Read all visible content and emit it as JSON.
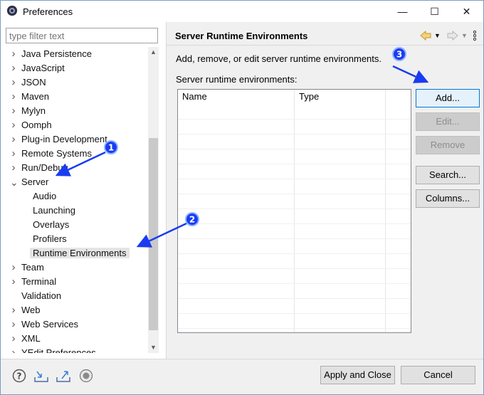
{
  "window": {
    "title": "Preferences",
    "minimize_glyph": "—",
    "maximize_glyph": "☐",
    "close_glyph": "✕"
  },
  "filter": {
    "placeholder": "type filter text"
  },
  "tree": {
    "items": [
      {
        "label": "Java Persistence",
        "expandable": true
      },
      {
        "label": "JavaScript",
        "expandable": true
      },
      {
        "label": "JSON",
        "expandable": true
      },
      {
        "label": "Maven",
        "expandable": true
      },
      {
        "label": "Mylyn",
        "expandable": true
      },
      {
        "label": "Oomph",
        "expandable": true
      },
      {
        "label": "Plug-in Development",
        "expandable": true
      },
      {
        "label": "Remote Systems",
        "expandable": true
      },
      {
        "label": "Run/Debug",
        "expandable": true
      },
      {
        "label": "Server",
        "expandable": true,
        "expanded": true
      },
      {
        "label": "Audio",
        "child": true
      },
      {
        "label": "Launching",
        "child": true
      },
      {
        "label": "Overlays",
        "child": true
      },
      {
        "label": "Profilers",
        "child": true
      },
      {
        "label": "Runtime Environments",
        "child": true,
        "selected": true
      },
      {
        "label": "Team",
        "expandable": true
      },
      {
        "label": "Terminal",
        "expandable": true
      },
      {
        "label": "Validation",
        "expandable": false
      },
      {
        "label": "Web",
        "expandable": true
      },
      {
        "label": "Web Services",
        "expandable": true
      },
      {
        "label": "XML",
        "expandable": true
      },
      {
        "label": "YEdit Preferences",
        "expandable": true
      }
    ]
  },
  "page": {
    "title": "Server Runtime Environments",
    "description": "Add, remove, or edit server runtime environments.",
    "list_label": "Server runtime environments:",
    "columns": [
      "Name",
      "Type"
    ]
  },
  "buttons": {
    "add": "Add...",
    "edit": "Edit...",
    "remove": "Remove",
    "search": "Search...",
    "columns": "Columns...",
    "apply_close": "Apply and Close",
    "cancel": "Cancel"
  },
  "annotations": {
    "markers": [
      "1",
      "2",
      "3"
    ],
    "color": "#1a3cf0"
  },
  "icons": {
    "app": "eclipse-icon",
    "back": "back-arrow-icon",
    "forward": "forward-arrow-icon",
    "menu": "view-menu-icon",
    "help": "help-icon",
    "import": "import-icon",
    "export": "export-icon",
    "record": "record-icon"
  }
}
